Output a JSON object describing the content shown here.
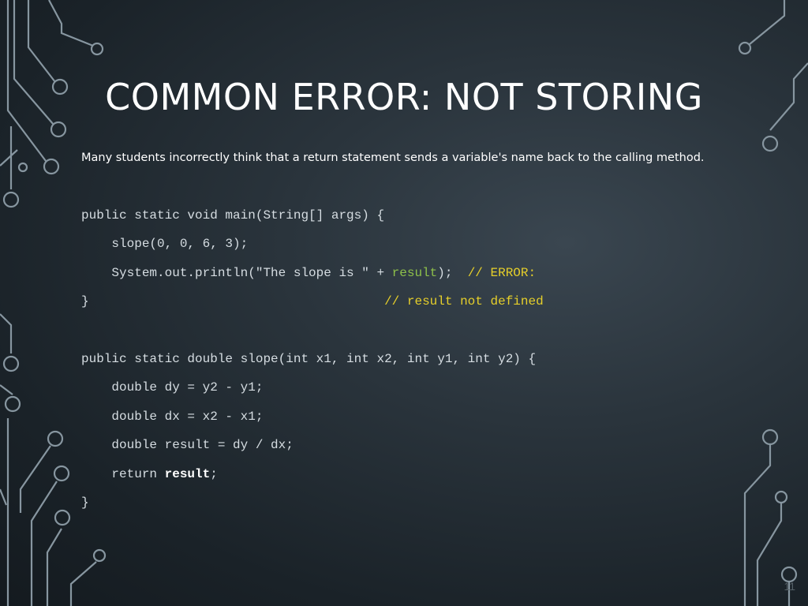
{
  "slide": {
    "title": "COMMON ERROR: NOT STORING",
    "subtitle": "Many students incorrectly think that a return statement sends a variable's name back to the calling method.",
    "page_number": "11"
  },
  "code": {
    "lines": [
      "public static void main(String[] args) {",
      "    slope(0, 0, 6, 3);",
      {
        "before": "    System.out.println(\"The slope is \" + ",
        "highlight": "result",
        "after": ");  ",
        "comment": "// ERROR:"
      },
      {
        "before": "}                                       ",
        "comment": "// result not defined"
      },
      "",
      "public static double slope(int x1, int x2, int y1, int y2) {",
      "    double dy = y2 - y1;",
      "    double dx = x2 - x1;",
      "    double result = dy / dx;",
      {
        "before": "    return ",
        "bold": "result",
        "after": ";"
      },
      "}"
    ]
  },
  "colors": {
    "highlight": "#8ec04a",
    "comment": "#e6cf2a"
  }
}
